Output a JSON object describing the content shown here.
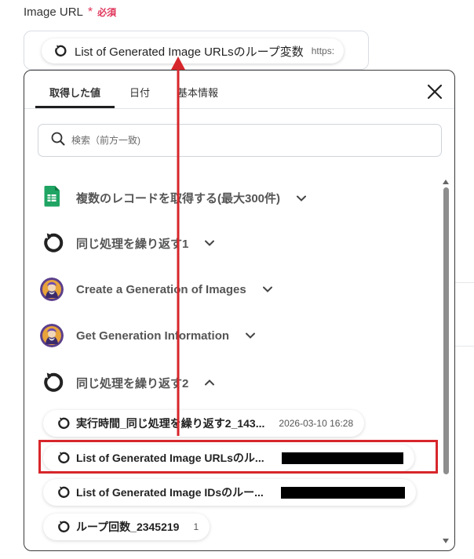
{
  "field": {
    "label": "Image URL",
    "required_star": "*",
    "required_text": "必須"
  },
  "url_input": {
    "chip_label": "List of Generated Image URLsのループ変数",
    "chip_value": "https:"
  },
  "tabs": [
    {
      "label": "取得した値",
      "active": true
    },
    {
      "label": "日付",
      "active": false
    },
    {
      "label": "基本情報",
      "active": false
    }
  ],
  "search": {
    "placeholder": "検索（前方一致)"
  },
  "sections": [
    {
      "label": "複数のレコードを取得する(最大300件)",
      "icon": "google-sheets-icon",
      "state": "collapsed"
    },
    {
      "label": "同じ処理を繰り返す1",
      "icon": "loop-icon",
      "state": "collapsed"
    },
    {
      "label": "Create a Generation of Images",
      "icon": "leonardo-ai-icon",
      "state": "collapsed"
    },
    {
      "label": "Get Generation Information",
      "icon": "leonardo-ai-icon",
      "state": "collapsed"
    },
    {
      "label": "同じ処理を繰り返す2",
      "icon": "loop-icon",
      "state": "expanded"
    }
  ],
  "items": [
    {
      "label": "実行時間_同じ処理を繰り返す2_143...",
      "value": "2026-03-10 16:28"
    },
    {
      "label": "List of Generated Image URLsのル...",
      "value": "",
      "redacted": true,
      "highlighted": true
    },
    {
      "label": "List of Generated Image IDsのルー...",
      "value": "",
      "redacted": true
    },
    {
      "label": "ループ回数_2345219",
      "value": "1"
    }
  ],
  "colors": {
    "required": "#e0365b",
    "annotation_red": "#d7262b",
    "sheets_green": "#1fa463",
    "text_dark": "#222222",
    "section_text": "#555555"
  }
}
